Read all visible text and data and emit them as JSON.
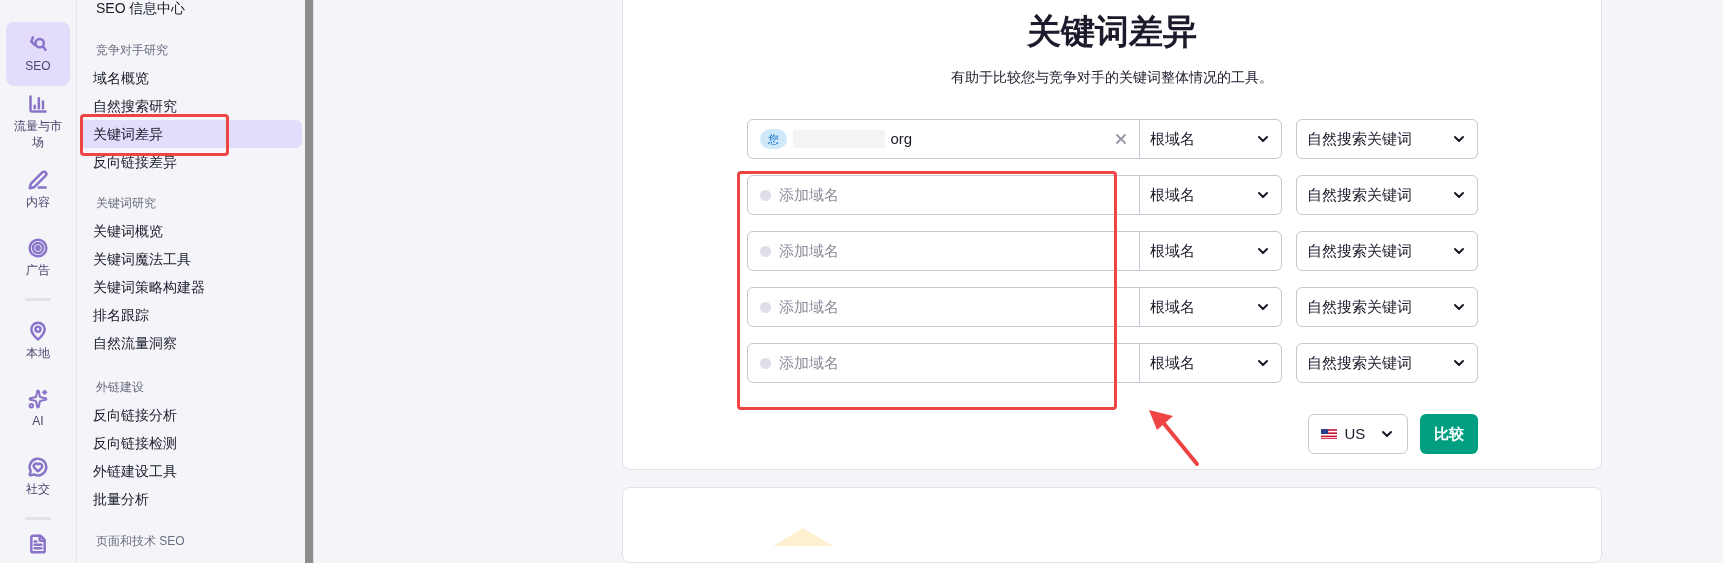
{
  "rail": {
    "groups": [
      [
        {
          "label": "SEO",
          "selected": true
        },
        {
          "label": "流量与市场",
          "selected": false
        },
        {
          "label": "内容",
          "selected": false
        },
        {
          "label": "广告",
          "selected": false
        }
      ],
      [
        {
          "label": "本地",
          "selected": false
        },
        {
          "label": "AI",
          "selected": false
        },
        {
          "label": "社交",
          "selected": false
        }
      ],
      [
        {
          "selected": false
        }
      ]
    ]
  },
  "sidebar": {
    "top_item": "SEO 信息中心",
    "sections": [
      {
        "title": "竞争对手研究",
        "items": [
          {
            "label": "域名概览",
            "selected": false
          },
          {
            "label": "自然搜索研究",
            "selected": false
          },
          {
            "label": "关键词差异",
            "selected": true
          },
          {
            "label": "反向链接差异",
            "selected": false
          }
        ]
      },
      {
        "title": "关键词研究",
        "items": [
          {
            "label": "关键词概览",
            "selected": false
          },
          {
            "label": "关键词魔法工具",
            "selected": false
          },
          {
            "label": "关键词策略构建器",
            "selected": false
          },
          {
            "label": "排名跟踪",
            "selected": false
          },
          {
            "label": "自然流量洞察",
            "selected": false
          }
        ]
      },
      {
        "title": "外链建设",
        "items": [
          {
            "label": "反向链接分析",
            "selected": false
          },
          {
            "label": "反向链接检测",
            "selected": false
          },
          {
            "label": "外链建设工具",
            "selected": false
          },
          {
            "label": "批量分析",
            "selected": false
          }
        ]
      },
      {
        "title": "页面和技术 SEO"
      }
    ]
  },
  "main": {
    "title": "关键词差异",
    "subtitle": "有助于比较您与竞争对手的关键词整体情况的工具。",
    "rows": [
      {
        "kind": "you",
        "badge": "您",
        "value": "org",
        "scope": "根域名",
        "keyword_type": "自然搜索关键词"
      },
      {
        "kind": "empty",
        "placeholder": "添加域名",
        "scope": "根域名",
        "keyword_type": "自然搜索关键词"
      },
      {
        "kind": "empty",
        "placeholder": "添加域名",
        "scope": "根域名",
        "keyword_type": "自然搜索关键词"
      },
      {
        "kind": "empty",
        "placeholder": "添加域名",
        "scope": "根域名",
        "keyword_type": "自然搜索关键词"
      },
      {
        "kind": "empty",
        "placeholder": "添加域名",
        "scope": "根域名",
        "keyword_type": "自然搜索关键词"
      }
    ],
    "database": "US",
    "compare_button": "比较"
  }
}
